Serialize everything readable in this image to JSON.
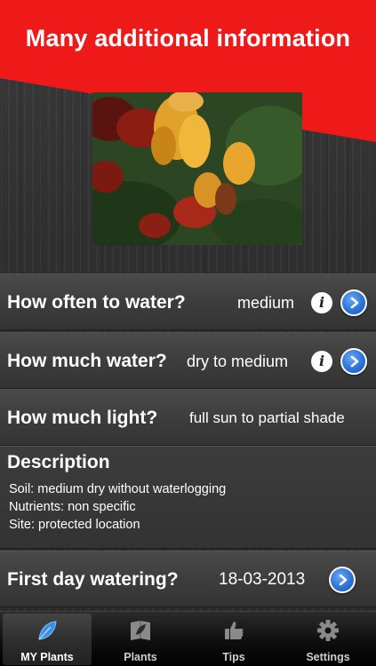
{
  "banner": {
    "title": "Many additional information"
  },
  "rows": [
    {
      "label": "How often to water?",
      "value": "medium"
    },
    {
      "label": "How much water?",
      "value": "dry to medium"
    },
    {
      "label": "How much light?",
      "value": "full sun to partial shade"
    }
  ],
  "description": {
    "title": "Description",
    "lines": [
      "Soil: medium dry without waterlogging",
      "Nutrients: non specific",
      "Site: protected location"
    ]
  },
  "watering": {
    "label": "First day watering?",
    "date": "18-03-2013"
  },
  "tabs": [
    {
      "label": "MY Plants",
      "icon": "leaf-icon",
      "active": true
    },
    {
      "label": "Plants",
      "icon": "book-leaf-icon",
      "active": false
    },
    {
      "label": "Tips",
      "icon": "thumbs-up-icon",
      "active": false
    },
    {
      "label": "Settings",
      "icon": "gear-icon",
      "active": false
    }
  ],
  "colors": {
    "banner": "#ee1a1a",
    "accent": "#2d73d8"
  }
}
